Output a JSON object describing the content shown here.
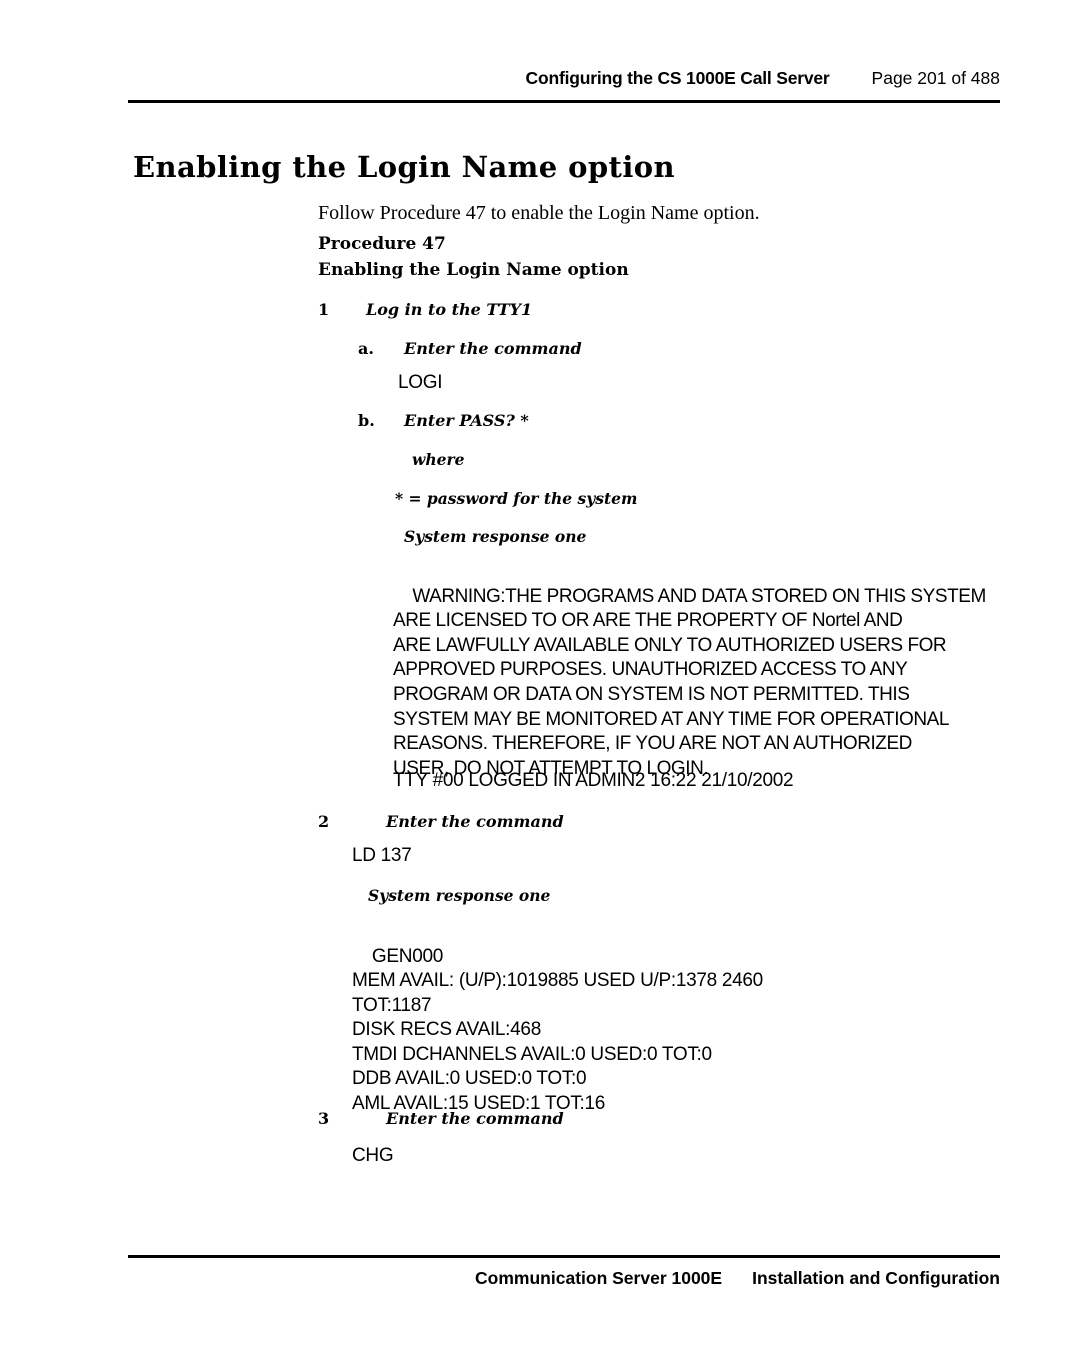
{
  "header": {
    "title": "Configuring the CS 1000E Call Server",
    "page_label": "Page 201 of 488"
  },
  "footer": {
    "left": "Communication Server 1000E",
    "right": "Installation and Configuration"
  },
  "page_title": "Enabling the Login Name option",
  "intro": "Follow Procedure 47 to enable the Login Name option.",
  "procedure": {
    "label": "Procedure 47",
    "title": "Enabling the Login Name option"
  },
  "steps": [
    {
      "number": "1",
      "text": "Log in to the TTY1"
    },
    {
      "number": "a.",
      "text": "Enter the command"
    },
    {
      "number": "b.",
      "text": "Enter PASS? *"
    },
    {
      "number": "2",
      "text": "Enter the command"
    },
    {
      "number": "3",
      "text": "Enter the command"
    }
  ],
  "commands": {
    "login": "LOGI",
    "ld137": "LD 137",
    "chg": "CHG"
  },
  "notes": {
    "where": "where",
    "asterisk_def": "* = password for the system",
    "system_response_1": "System response one",
    "system_response_2": "System response one"
  },
  "warning": {
    "lines": [
      "WARNING:THE PROGRAMS AND DATA STORED ON THIS SYSTEM",
      "ARE LICENSED TO OR ARE THE PROPERTY OF Nortel AND",
      "ARE LAWFULLY AVAILABLE ONLY TO AUTHORIZED USERS FOR",
      "APPROVED PURPOSES. UNAUTHORIZED ACCESS TO ANY",
      "PROGRAM OR DATA ON SYSTEM IS NOT PERMITTED. THIS",
      "SYSTEM MAY BE MONITORED AT ANY TIME FOR OPERATIONAL",
      "REASONS. THEREFORE, IF YOU ARE NOT AN AUTHORIZED",
      "USER, DO NOT ATTEMPT TO LOGIN."
    ],
    "tty_line": "TTY #00 LOGGED IN ADMIN2 16:22 21/10/2002"
  },
  "ld137_output": {
    "lines": [
      "GEN000",
      "MEM AVAIL: (U/P):1019885 USED U/P:1378 2460",
      "TOT:1187",
      "DISK RECS AVAIL:468",
      "TMDI DCHANNELS AVAIL:0 USED:0 TOT:0",
      "DDB AVAIL:0 USED:0 TOT:0",
      "AML AVAIL:15 USED:1 TOT:16"
    ]
  }
}
